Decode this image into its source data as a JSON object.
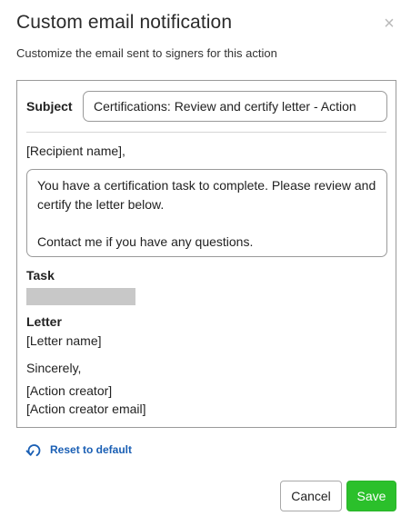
{
  "dialog": {
    "title": "Custom email notification",
    "subtitle": "Customize the email sent to signers for this action",
    "close_icon": "close-icon",
    "close_glyph": "×"
  },
  "email": {
    "subject_label": "Subject",
    "subject_value": "Certifications: Review and certify letter - Action",
    "greeting": "[Recipient name],",
    "body_text": "You have a certification task to complete. Please review and certify the letter below.\n\nContact me if you have any questions.",
    "task_label": "Task",
    "letter_label": "Letter",
    "letter_name": "[Letter name]",
    "closing": "Sincerely,",
    "creator_name": "[Action creator]",
    "creator_email": "[Action creator email]"
  },
  "actions": {
    "reset_label": "Reset to default",
    "reset_icon": "undo-icon",
    "cancel_label": "Cancel",
    "save_label": "Save"
  },
  "colors": {
    "link": "#1a5fb4",
    "save": "#2bc02b",
    "task_placeholder": "#c8c8c8",
    "border": "#9a9a9a"
  }
}
